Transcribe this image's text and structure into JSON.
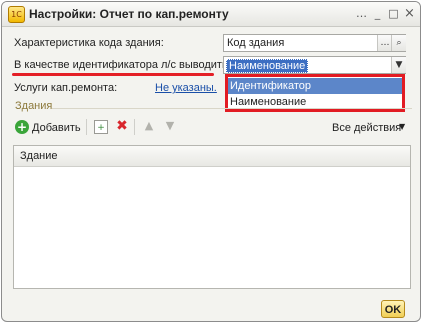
{
  "window": {
    "title": "Настройки: Отчет по кап.ремонту",
    "icon": "1c-app-icon",
    "controls": {
      "more": "…",
      "minimize": "_",
      "maximize": "□",
      "close": "×"
    }
  },
  "form": {
    "building_code_label": "Характеристика кода здания:",
    "building_code_value": "Код здания",
    "identifier_label": "В качестве идентификатора л/с выводить:",
    "identifier_value": "Наименование",
    "services_label": "Услуги кап.ремонта:",
    "services_link": "Не указаны."
  },
  "dropdown": {
    "options": [
      "Идентификатор",
      "Наименование"
    ],
    "highlighted_index": 0
  },
  "buildings": {
    "section_title": "Здания",
    "toolbar": {
      "add_label": "Добавить",
      "all_actions_label": "Все действия"
    },
    "table": {
      "columns": [
        "Здание"
      ],
      "rows": []
    }
  },
  "footer": {
    "ok_label": "OK"
  },
  "colors": {
    "annotation_red": "#e21b23",
    "selection_blue": "#3c6ec2",
    "link_blue": "#1a4fa8"
  }
}
